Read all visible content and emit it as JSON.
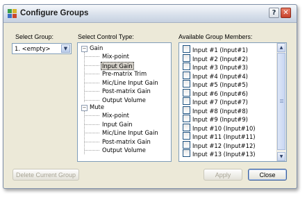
{
  "window": {
    "title": "Configure Groups"
  },
  "select_group": {
    "label": "Select Group:",
    "value": "1. <empty>"
  },
  "control_type": {
    "label": "Select Control Type:",
    "gain": {
      "label": "Gain",
      "children": [
        "Mix-point",
        "Input Gain",
        "Pre-matrix Trim",
        "Mic/Line Input Gain",
        "Post-matrix Gain",
        "Output Volume"
      ],
      "selected": "Input Gain"
    },
    "mute": {
      "label": "Mute",
      "children": [
        "Mix-point",
        "Input Gain",
        "Mic/Line Input Gain",
        "Post-matrix Gain",
        "Output Volume"
      ]
    }
  },
  "members": {
    "label": "Available Group Members:",
    "items": [
      "Input #1 (Input#1)",
      "Input #2 (Input#2)",
      "Input #3 (Input#3)",
      "Input #4 (Input#4)",
      "Input #5 (Input#5)",
      "Input #6 (Input#6)",
      "Input #7 (Input#7)",
      "Input #8 (Input#8)",
      "Input #9 (Input#9)",
      "Input #10 (Input#10)",
      "Input #11 (Input#11)",
      "Input #12 (Input#12)",
      "Input #13 (Input#13)"
    ]
  },
  "buttons": {
    "delete": "Delete Current Group",
    "apply": "Apply",
    "close": "Close"
  }
}
